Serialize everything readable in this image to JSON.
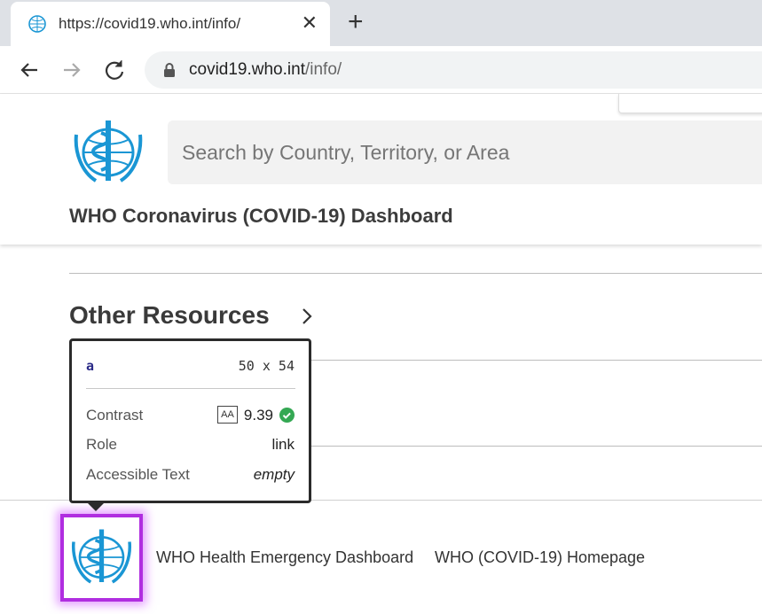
{
  "browser": {
    "tab_title": "https://covid19.who.int/info/",
    "url_host": "covid19.who.int",
    "url_path": "/info/"
  },
  "header": {
    "search_placeholder": "Search by Country, Territory, or Area",
    "dashboard_title": "WHO Coronavirus (COVID-19) Dashboard"
  },
  "main": {
    "section_title": "Other Resources"
  },
  "tooltip": {
    "tag": "a",
    "dimensions": "50 x 54",
    "contrast_label": "Contrast",
    "contrast_badge": "AA",
    "contrast_value": "9.39",
    "role_label": "Role",
    "role_value": "link",
    "accessible_label": "Accessible Text",
    "accessible_value": "empty"
  },
  "footer": {
    "links": [
      "WHO Health Emergency Dashboard",
      "WHO (COVID-19) Homepage"
    ]
  },
  "colors": {
    "who_blue": "#1a96d4",
    "highlight": "#b02ee0",
    "check_green": "#34a853"
  }
}
